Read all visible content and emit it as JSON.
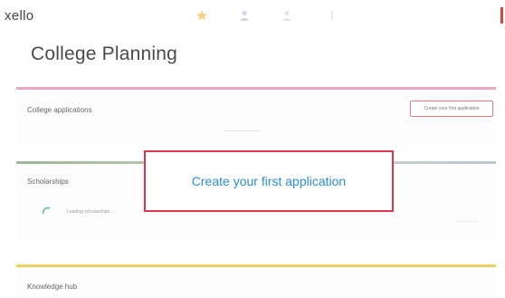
{
  "app": {
    "logo": "xello"
  },
  "nav": {
    "icons": [
      "star-icon",
      "person-icon",
      "person-icon",
      "info-icon"
    ]
  },
  "page": {
    "title": "College Planning"
  },
  "sections": {
    "college_applications": {
      "title": "College applications",
      "button_label": "Create your first application"
    },
    "scholarships": {
      "title": "Scholarships",
      "hint": "Loading scholarships…"
    },
    "knowledge_hub": {
      "title": "Knowledge hub"
    }
  },
  "callout": {
    "label": "Create your first application",
    "border_color": "#d9374b",
    "text_color": "#2a8ed4"
  },
  "colors": {
    "applications_accent": "#e9a7c4",
    "scholarships_accent": "#9fb79a",
    "knowledge_accent": "#f0d264"
  }
}
